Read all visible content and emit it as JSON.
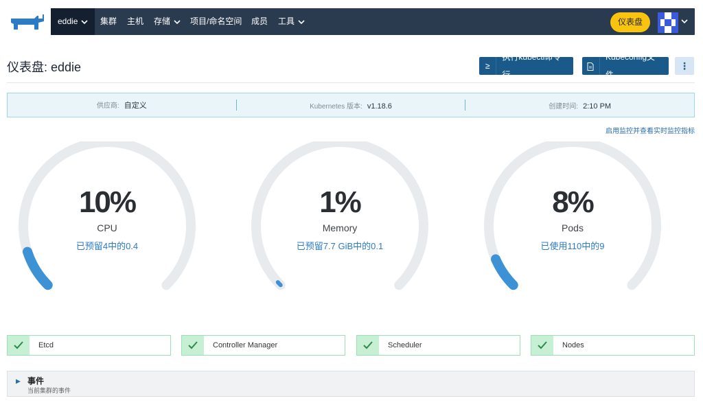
{
  "nav": {
    "cluster_menu": "eddie",
    "items": [
      "集群",
      "主机",
      "存储",
      "项目/命名空间",
      "成员",
      "工具"
    ],
    "dashboard_button": "仪表盘"
  },
  "header": {
    "title": "仪表盘: eddie",
    "kubectl_button": "执行kubectl命令行",
    "kubectl_icon": "≥",
    "kubeconfig_button": "Kubeconfig文件",
    "more_icon": "⋮"
  },
  "info": {
    "provider_key": "供应商:",
    "provider_val": "自定义",
    "k8s_key": "Kubernetes 版本:",
    "k8s_val": "v1.18.6",
    "created_key": "创建时间:",
    "created_val": "2:10 PM"
  },
  "monitor_link": "启用监控并查看实时监控指标",
  "gauges": [
    {
      "percent": "10%",
      "fraction": 0.1,
      "label": "CPU",
      "sub": "已预留4中的0.4"
    },
    {
      "percent": "1%",
      "fraction": 0.01,
      "label": "Memory",
      "sub": "已预留7.7 GiB中的0.1"
    },
    {
      "percent": "8%",
      "fraction": 0.08,
      "label": "Pods",
      "sub": "已使用110中的9"
    }
  ],
  "health": [
    "Etcd",
    "Controller Manager",
    "Scheduler",
    "Nodes"
  ],
  "events": {
    "title": "事件",
    "subtitle": "当前集群的事件",
    "arrow": "▶"
  },
  "colors": {
    "navbar": "#2a3a4f",
    "accent_yellow": "#f8c40d",
    "gauge_fill": "#3d92d6",
    "gauge_track": "#e8ebed",
    "healthy": "#3aa762"
  }
}
